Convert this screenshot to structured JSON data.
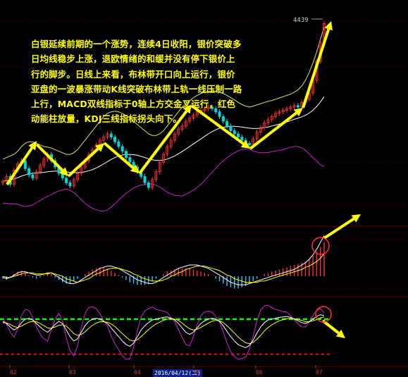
{
  "annotation": "白银延续前期的一个涨势，连续4日收阳，银价突破多日均线稳步上涨，退欧情绪的和缓并没有停下银价上行的脚步。日线上来看，布林带开口向上运行，银价亚盘的一波暴涨带动K线突破布林带上轨一线压制一路上行，MACD双线指标于0轴上方交金叉运行，红色动能柱放量，KDJ三线指标拐头向下。",
  "price_label": "4439",
  "x_labels": [
    "02",
    "03",
    "04",
    "2016/04/12(二)",
    "05",
    "06",
    "07"
  ],
  "colors": {
    "background": "#000000",
    "candle_up": "#ff3030",
    "candle_down": "#00d8d8",
    "boll_upper": "#e0e060",
    "boll_mid": "#ffffff",
    "boll_lower": "#c020c0",
    "arrow": "#ffff00",
    "macd_pos": "#ff3030",
    "macd_neg": "#40c0ff",
    "kdj_k": "#ffffff",
    "kdj_d": "#ffff00",
    "kdj_j": "#d020d0",
    "ref_green": "#00ff00",
    "ref_red": "#ff0000",
    "circle": "#ff3030"
  },
  "chart_data": {
    "type": "candlestick",
    "price_panel": {
      "note": "daily silver price, Bollinger bands",
      "close": [
        3920,
        3935,
        3910,
        3955,
        3975,
        3985,
        3960,
        3940,
        3930,
        3950,
        3970,
        3990,
        4005,
        3985,
        3965,
        3945,
        3930,
        3915,
        3905,
        3925,
        3945,
        3965,
        3985,
        4005,
        4020,
        4035,
        4050,
        4060,
        4070,
        4060,
        4045,
        4030,
        4015,
        3995,
        3980,
        3965,
        3950,
        3935,
        3915,
        3900,
        3925,
        3950,
        3980,
        4005,
        4030,
        4050,
        4070,
        4085,
        4095,
        4110,
        4120,
        4130,
        4140,
        4145,
        4150,
        4155,
        4150,
        4140,
        4125,
        4110,
        4095,
        4080,
        4070,
        4060,
        4050,
        4040,
        4035,
        4055,
        4075,
        4090,
        4105,
        4115,
        4125,
        4135,
        4140,
        4145,
        4150,
        4155,
        4160,
        4155,
        4170,
        4180,
        4200,
        4240,
        4300,
        4360,
        4420
      ],
      "boll_upper": [
        3990,
        3995,
        4000,
        4005,
        4015,
        4030,
        4040,
        4045,
        4045,
        4040,
        4035,
        4030,
        4028,
        4025,
        4020,
        4015,
        4010,
        4005,
        4005,
        4010,
        4020,
        4035,
        4050,
        4065,
        4080,
        4095,
        4110,
        4125,
        4135,
        4140,
        4142,
        4140,
        4135,
        4128,
        4120,
        4110,
        4100,
        4090,
        4080,
        4070,
        4065,
        4065,
        4070,
        4080,
        4095,
        4110,
        4125,
        4140,
        4155,
        4165,
        4175,
        4185,
        4192,
        4198,
        4202,
        4205,
        4206,
        4205,
        4202,
        4198,
        4192,
        4185,
        4178,
        4170,
        4163,
        4158,
        4155,
        4158,
        4162,
        4166,
        4170,
        4173,
        4176,
        4180,
        4184,
        4188,
        4192,
        4196,
        4202,
        4210,
        4222,
        4240,
        4265,
        4295,
        4330,
        4370,
        4410
      ],
      "boll_mid": [
        3920,
        3922,
        3924,
        3927,
        3931,
        3936,
        3940,
        3943,
        3945,
        3946,
        3947,
        3948,
        3950,
        3951,
        3952,
        3952,
        3951,
        3950,
        3948,
        3947,
        3947,
        3948,
        3950,
        3953,
        3957,
        3962,
        3968,
        3975,
        3982,
        3989,
        3995,
        4000,
        4003,
        4005,
        4005,
        4004,
        4002,
        3999,
        3995,
        3991,
        3988,
        3986,
        3986,
        3987,
        3990,
        3995,
        4000,
        4007,
        4014,
        4022,
        4030,
        4038,
        4046,
        4054,
        4062,
        4070,
        4077,
        4083,
        4088,
        4091,
        4093,
        4094,
        4094,
        4093,
        4092,
        4090,
        4088,
        4087,
        4087,
        4088,
        4090,
        4092,
        4095,
        4098,
        4101,
        4104,
        4108,
        4112,
        4116,
        4120,
        4124,
        4129,
        4136,
        4145,
        4157,
        4171,
        4188
      ],
      "boll_lower": [
        3850,
        3850,
        3848,
        3848,
        3847,
        3842,
        3840,
        3841,
        3845,
        3852,
        3859,
        3866,
        3872,
        3877,
        3884,
        3889,
        3892,
        3895,
        3891,
        3884,
        3874,
        3861,
        3850,
        3841,
        3834,
        3829,
        3826,
        3825,
        3829,
        3838,
        3848,
        3860,
        3871,
        3882,
        3890,
        3898,
        3904,
        3908,
        3910,
        3912,
        3911,
        3907,
        3902,
        3894,
        3885,
        3880,
        3875,
        3874,
        3873,
        3879,
        3885,
        3891,
        3900,
        3910,
        3922,
        3935,
        3948,
        3961,
        3974,
        3984,
        3994,
        4003,
        4010,
        4016,
        4021,
        4022,
        4021,
        4016,
        4012,
        4010,
        4010,
        4011,
        4014,
        4016,
        4018,
        4020,
        4024,
        4028,
        4030,
        4030,
        4026,
        4018,
        4007,
        3995,
        3984,
        3972,
        3966
      ],
      "ylim": [
        3880,
        4450
      ]
    },
    "macd_panel": {
      "histogram": [
        -2,
        -3,
        -1,
        2,
        4,
        5,
        3,
        1,
        -1,
        -2,
        -1,
        1,
        3,
        2,
        -1,
        -3,
        -5,
        -6,
        -6,
        -4,
        -2,
        0,
        2,
        4,
        6,
        7,
        8,
        8,
        7,
        5,
        3,
        1,
        -1,
        -3,
        -5,
        -6,
        -7,
        -7,
        -7,
        -6,
        -4,
        -2,
        0,
        2,
        4,
        5,
        6,
        7,
        7,
        7,
        7,
        6,
        5,
        4,
        3,
        2,
        0,
        -2,
        -4,
        -6,
        -8,
        -9,
        -10,
        -10,
        -9,
        -8,
        -6,
        -4,
        -2,
        0,
        2,
        3,
        4,
        5,
        6,
        7,
        8,
        9,
        10,
        11,
        12,
        13,
        15,
        18,
        22,
        26,
        30
      ],
      "dif": [
        -1,
        -2,
        -1,
        1,
        3,
        4,
        4,
        3,
        2,
        1,
        1,
        2,
        3,
        3,
        1,
        -1,
        -3,
        -5,
        -6,
        -6,
        -5,
        -3,
        -1,
        1,
        3,
        5,
        7,
        8,
        9,
        9,
        8,
        7,
        5,
        3,
        1,
        -1,
        -3,
        -4,
        -5,
        -6,
        -6,
        -5,
        -3,
        -1,
        1,
        3,
        5,
        7,
        8,
        9,
        10,
        10,
        10,
        9,
        8,
        7,
        5,
        3,
        1,
        -1,
        -3,
        -5,
        -6,
        -7,
        -7,
        -7,
        -6,
        -5,
        -4,
        -3,
        -2,
        -1,
        0,
        1,
        2,
        3,
        4,
        5,
        6,
        8,
        10,
        12,
        15,
        19,
        24,
        30,
        36
      ],
      "dea": [
        0,
        -1,
        -1,
        0,
        1,
        2,
        3,
        3,
        3,
        2,
        2,
        2,
        2,
        3,
        2,
        1,
        0,
        -2,
        -3,
        -4,
        -5,
        -4,
        -3,
        -2,
        0,
        2,
        3,
        5,
        6,
        7,
        7,
        7,
        6,
        5,
        4,
        2,
        1,
        -1,
        -2,
        -3,
        -4,
        -4,
        -4,
        -3,
        -2,
        0,
        1,
        3,
        4,
        6,
        7,
        8,
        9,
        9,
        9,
        8,
        7,
        6,
        5,
        3,
        1,
        0,
        -2,
        -3,
        -4,
        -5,
        -5,
        -5,
        -5,
        -4,
        -4,
        -3,
        -2,
        -1,
        0,
        1,
        2,
        3,
        4,
        5,
        6,
        8,
        9,
        11,
        13,
        16,
        20
      ],
      "ylim": [
        -15,
        40
      ]
    },
    "kdj_panel": {
      "k": [
        75,
        70,
        62,
        55,
        60,
        72,
        80,
        82,
        78,
        70,
        62,
        55,
        50,
        58,
        68,
        75,
        70,
        55,
        40,
        30,
        35,
        50,
        65,
        75,
        80,
        82,
        80,
        75,
        70,
        60,
        50,
        40,
        30,
        22,
        18,
        25,
        40,
        55,
        65,
        72,
        78,
        80,
        82,
        84,
        85,
        82,
        78,
        70,
        60,
        50,
        45,
        50,
        60,
        70,
        76,
        80,
        82,
        80,
        75,
        65,
        52,
        40,
        30,
        22,
        18,
        15,
        20,
        32,
        48,
        62,
        72,
        78,
        80,
        82,
        84,
        85,
        86,
        84,
        80,
        76,
        72,
        70,
        74,
        80,
        86,
        90,
        88
      ],
      "d": [
        72,
        71,
        68,
        63,
        61,
        64,
        69,
        73,
        75,
        74,
        70,
        65,
        60,
        59,
        62,
        66,
        67,
        64,
        56,
        47,
        43,
        45,
        51,
        59,
        66,
        71,
        74,
        74,
        73,
        69,
        63,
        55,
        47,
        39,
        32,
        30,
        33,
        40,
        48,
        56,
        63,
        69,
        73,
        77,
        80,
        81,
        80,
        77,
        71,
        64,
        58,
        55,
        57,
        61,
        66,
        71,
        75,
        77,
        76,
        72,
        65,
        57,
        48,
        39,
        32,
        26,
        24,
        27,
        34,
        43,
        53,
        61,
        67,
        72,
        76,
        79,
        81,
        82,
        81,
        79,
        77,
        74,
        74,
        76,
        79,
        83,
        85
      ],
      "j": [
        81,
        68,
        50,
        39,
        58,
        88,
        102,
        100,
        84,
        62,
        46,
        35,
        30,
        56,
        80,
        93,
        76,
        37,
        8,
        -4,
        19,
        60,
        93,
        107,
        108,
        104,
        92,
        77,
        64,
        42,
        24,
        10,
        -4,
        -12,
        -10,
        15,
        54,
        85,
        99,
        104,
        108,
        102,
        100,
        98,
        95,
        84,
        74,
        56,
        38,
        22,
        19,
        40,
        66,
        88,
        96,
        98,
        96,
        86,
        73,
        51,
        26,
        6,
        -6,
        -12,
        -10,
        -7,
        12,
        42,
        76,
        100,
        110,
        112,
        106,
        102,
        100,
        97,
        96,
        88,
        78,
        70,
        62,
        62,
        74,
        88,
        100,
        104,
        94
      ],
      "ylim": [
        -20,
        120
      ],
      "ref_high": 80,
      "ref_low": 0
    }
  }
}
